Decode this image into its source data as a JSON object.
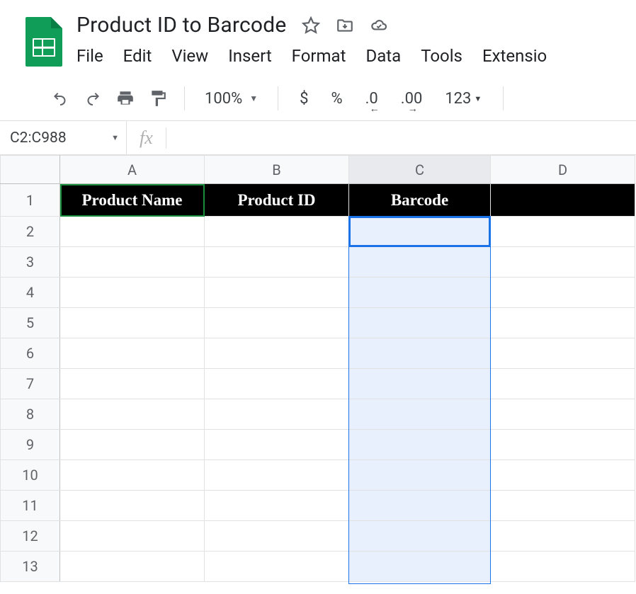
{
  "doc": {
    "title": "Product ID to Barcode"
  },
  "menu": {
    "file": "File",
    "edit": "Edit",
    "view": "View",
    "insert": "Insert",
    "format": "Format",
    "data": "Data",
    "tools": "Tools",
    "extensions": "Extensio"
  },
  "toolbar": {
    "zoom": "100%",
    "currency": "$",
    "percent": "%",
    "dec_decrease": ".0",
    "dec_increase": ".00",
    "more_formats": "123"
  },
  "namebox": {
    "value": "C2:C988"
  },
  "fx": {
    "label": "fx"
  },
  "columns": {
    "A": "A",
    "B": "B",
    "C": "C",
    "D": "D"
  },
  "rows": [
    "1",
    "2",
    "3",
    "4",
    "5",
    "6",
    "7",
    "8",
    "9",
    "10",
    "11",
    "12",
    "13"
  ],
  "sheet_headers": {
    "A": "Product Name",
    "B": "Product ID",
    "C": "Barcode",
    "D": ""
  }
}
